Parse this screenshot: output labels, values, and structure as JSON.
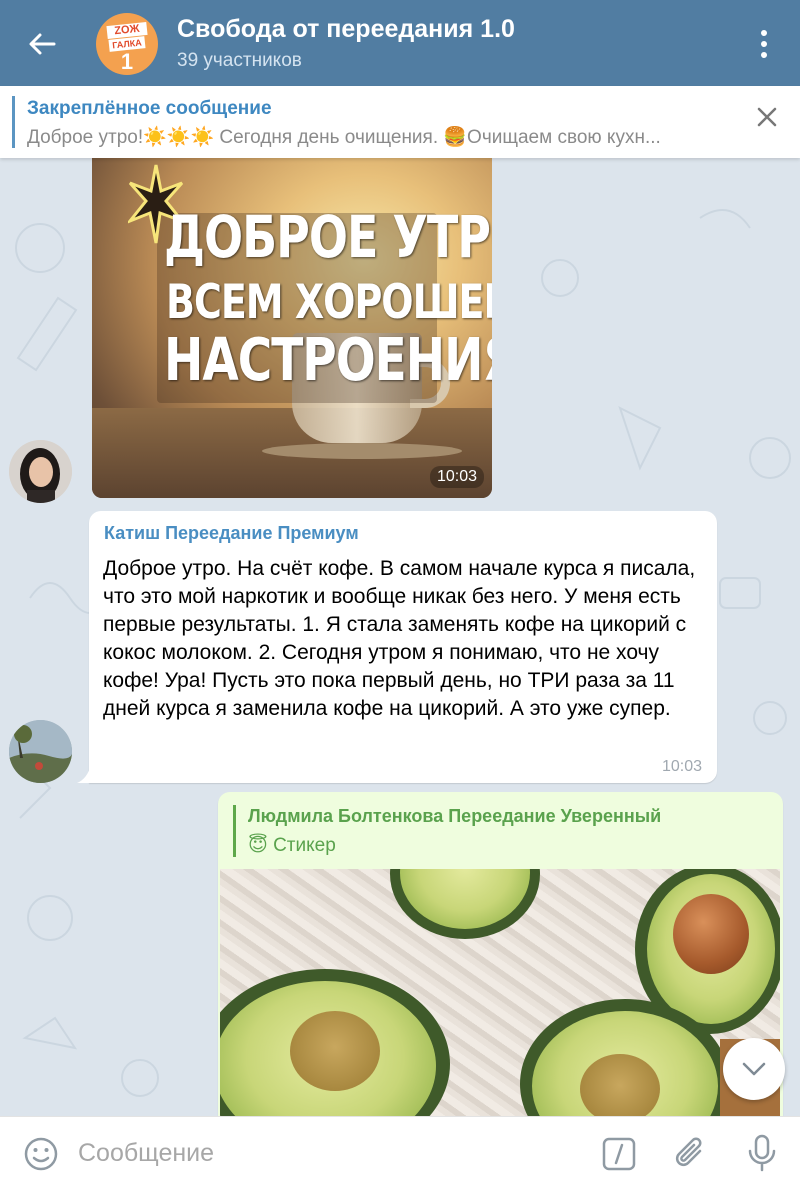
{
  "header": {
    "title": "Свобода от переедания 1.0",
    "members": "39 участников",
    "avatar": {
      "line1": "ZOЖ",
      "line2": "ГАЛКА",
      "number": "1"
    }
  },
  "pinned": {
    "title": "Закреплённое сообщение",
    "text": "Доброе утро!☀️☀️☀️   Сегодня день очищения.  🍔Очищаем свою кухн..."
  },
  "messages": {
    "photo": {
      "overlay_lines": [
        "ДОБРОЕ УТРО!",
        "ВСЕМ ХОРОШЕГО",
        "НАСТРОЕНИЯ"
      ],
      "time": "10:03"
    },
    "text": {
      "sender": "Катиш Переедание Премиум",
      "body": "Доброе утро. На счёт кофе. В самом начале курса я писала, что это мой наркотик и вообще никак без него. У меня есть первые результаты. 1. Я стала заменять кофе на цикорий с кокос молоком. 2. Сегодня утром я понимаю, что не хочу кофе! Ура! Пусть это пока первый день, но ТРИ раза за 11 дней курса я заменила кофе на цикорий. А это уже супер.",
      "time": "10:03"
    },
    "reply": {
      "reply_to_name": "Людмила Болтенкова Переедание Уверенный",
      "reply_to_text": "😇 Стикер"
    }
  },
  "input": {
    "placeholder": "Сообщение"
  },
  "colors": {
    "header": "#517da2",
    "accent": "#3e88c1",
    "reply": "#5aa24d",
    "outgoing": "#effdde"
  },
  "icons": [
    "back-arrow-icon",
    "more-vertical-icon",
    "close-icon",
    "emoji-icon",
    "bot-command-icon",
    "paperclip-icon",
    "microphone-icon",
    "chevron-down-icon"
  ]
}
